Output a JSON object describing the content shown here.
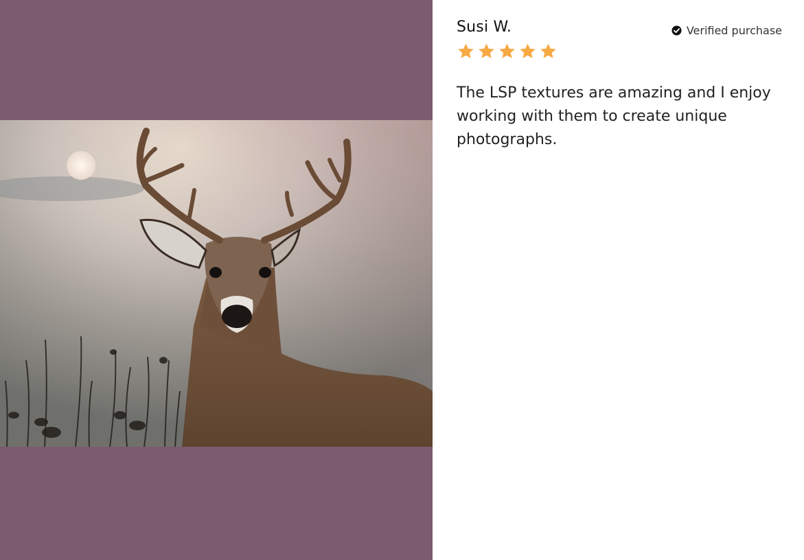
{
  "review": {
    "reviewer_name": "Susi W.",
    "verified_label": "Verified purchase",
    "rating": 5,
    "rating_max": 5,
    "text": "The LSP textures are amazing and I enjoy working with them to create unique photographs."
  },
  "media": {
    "photo_subject": "deer-photo",
    "background_color": "#7c5a70"
  },
  "colors": {
    "star": "#f7a944",
    "text": "#222222",
    "verified_icon": "#111111"
  },
  "icons": {
    "verified": "check-circle-icon",
    "star": "star-icon"
  }
}
